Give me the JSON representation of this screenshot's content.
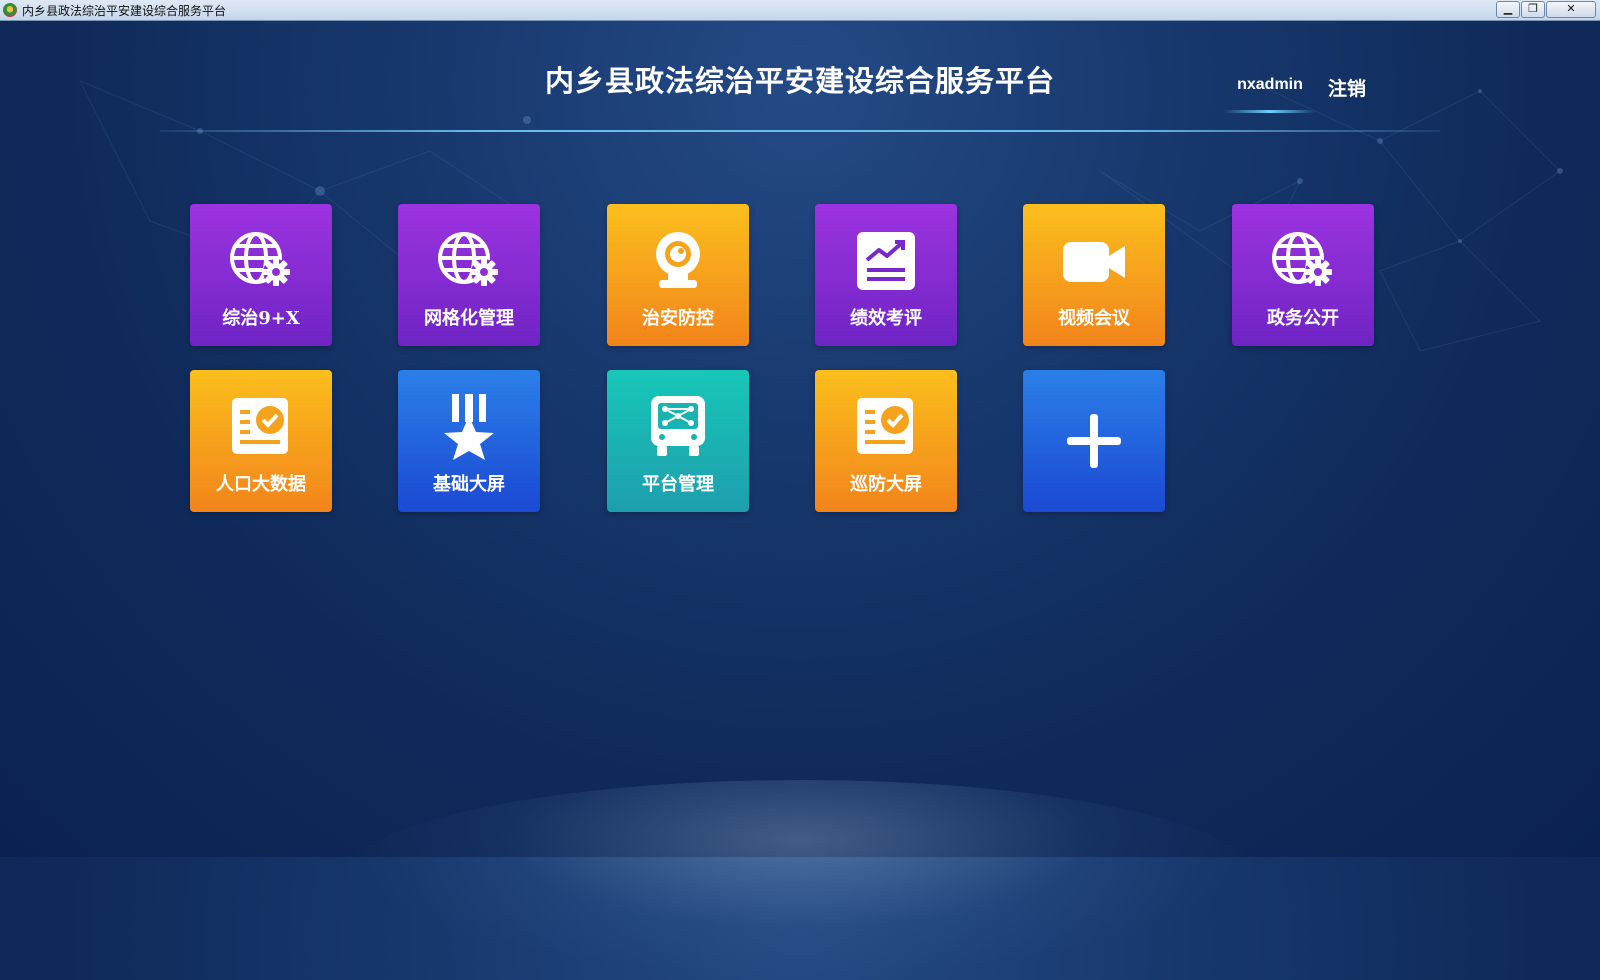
{
  "window": {
    "title": "内乡县政法综治平安建设综合服务平台",
    "min_glyph": "▁",
    "max_glyph": "❐",
    "close_glyph": "✕"
  },
  "header": {
    "title": "内乡县政法综治平安建设综合服务平台",
    "username": "nxadmin",
    "logout_label": "注销"
  },
  "colors": {
    "purple": "#8a2fd8",
    "orange": "#f7a51c",
    "blue": "#1f5fe0",
    "teal": "#19b6b3",
    "background": "#123266"
  },
  "tiles": [
    {
      "label": "综治9+X",
      "icon": "globe-gear-icon",
      "color": "purple"
    },
    {
      "label": "网格化管理",
      "icon": "globe-gear-icon",
      "color": "purple"
    },
    {
      "label": "治安防控",
      "icon": "webcam-icon",
      "color": "orange"
    },
    {
      "label": "绩效考评",
      "icon": "chart-doc-icon",
      "color": "purple"
    },
    {
      "label": "视频会议",
      "icon": "video-camera-icon",
      "color": "orange"
    },
    {
      "label": "政务公开",
      "icon": "globe-gear-icon",
      "color": "purple"
    },
    {
      "label": "人口大数据",
      "icon": "checklist-icon",
      "color": "orange"
    },
    {
      "label": "基础大屏",
      "icon": "medal-star-icon",
      "color": "blue"
    },
    {
      "label": "平台管理",
      "icon": "monitor-network-icon",
      "color": "teal"
    },
    {
      "label": "巡防大屏",
      "icon": "checklist-icon",
      "color": "orange"
    },
    {
      "label": "",
      "icon": "plus-icon",
      "color": "blue"
    }
  ]
}
